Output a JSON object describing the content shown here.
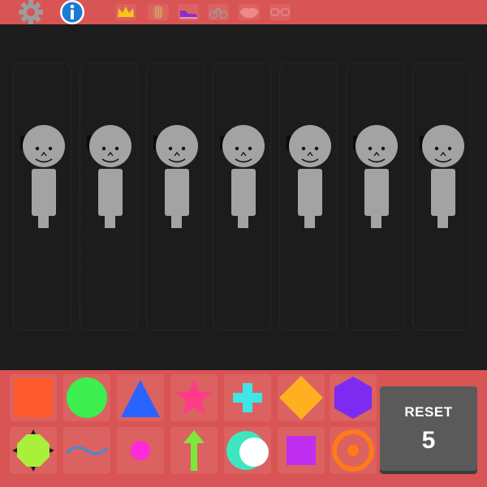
{
  "app": {
    "toolbar": {
      "settings_icon": "gear-icon",
      "info_icon": "info-icon",
      "categories": [
        {
          "name": "crown",
          "icon": "crown-icon",
          "color": "#f5c518"
        },
        {
          "name": "shell",
          "icon": "shell-icon",
          "color": "#c98a50"
        },
        {
          "name": "shoe",
          "icon": "shoe-icon",
          "color": "#8b2fc9"
        },
        {
          "name": "bike",
          "icon": "bike-icon",
          "color": "#9a9a9a"
        },
        {
          "name": "lips",
          "icon": "lips-icon",
          "color": "#f08a8a"
        },
        {
          "name": "glasses",
          "icon": "glasses-icon",
          "color": "#e08a8a"
        }
      ]
    },
    "stage": {
      "figure_count": 7,
      "figure_color": "#a3a3a3",
      "hair_color": "#0a0a0a"
    },
    "palette": {
      "shapes": [
        {
          "name": "square",
          "color": "#ff5a2e"
        },
        {
          "name": "circle",
          "color": "#3cee4e"
        },
        {
          "name": "triangle",
          "color": "#2b63ff"
        },
        {
          "name": "star",
          "color": "#ff3a8a"
        },
        {
          "name": "plus",
          "color": "#3ee6e6"
        },
        {
          "name": "diamond",
          "color": "#ffb020"
        },
        {
          "name": "hexagon",
          "color": "#7d2bf0"
        },
        {
          "name": "spiky-octagon",
          "color": "#a8f03a"
        },
        {
          "name": "wave",
          "color": "#3a8ed9"
        },
        {
          "name": "dot",
          "color": "#ff2ad9"
        },
        {
          "name": "arrow-up",
          "color": "#7de83a"
        },
        {
          "name": "crescent",
          "color": "#3ee6c0"
        },
        {
          "name": "small-square",
          "color": "#c02ef0"
        },
        {
          "name": "ring-target",
          "color": "#ff7a1a"
        }
      ]
    },
    "reset": {
      "label": "RESET",
      "count": "5"
    }
  }
}
